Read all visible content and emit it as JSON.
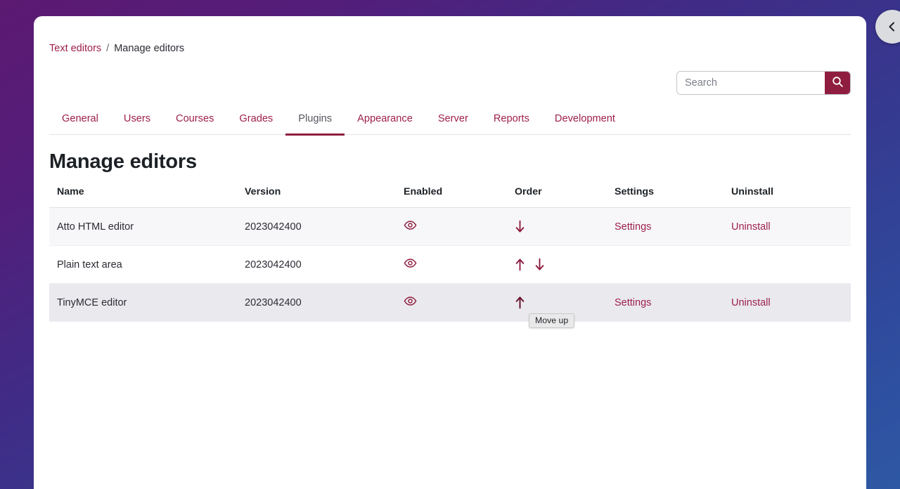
{
  "backdrop": {
    "drawer_toggle_icon": "chevron-left-icon"
  },
  "breadcrumb": {
    "parent": "Text editors",
    "separator": "/",
    "current": "Manage editors"
  },
  "search": {
    "placeholder": "Search",
    "value": "",
    "button_icon": "search-icon"
  },
  "tabs": [
    {
      "label": "General",
      "active": false
    },
    {
      "label": "Users",
      "active": false
    },
    {
      "label": "Courses",
      "active": false
    },
    {
      "label": "Grades",
      "active": false
    },
    {
      "label": "Plugins",
      "active": true
    },
    {
      "label": "Appearance",
      "active": false
    },
    {
      "label": "Server",
      "active": false
    },
    {
      "label": "Reports",
      "active": false
    },
    {
      "label": "Development",
      "active": false
    }
  ],
  "page": {
    "title": "Manage editors"
  },
  "table": {
    "headers": {
      "name": "Name",
      "version": "Version",
      "enabled": "Enabled",
      "order": "Order",
      "settings": "Settings",
      "uninstall": "Uninstall"
    },
    "rows": [
      {
        "name": "Atto HTML editor",
        "version": "2023042400",
        "enabled_icon": "eye-icon",
        "order_icons": [
          "arrow-down-icon"
        ],
        "settings_label": "Settings",
        "uninstall_label": "Uninstall"
      },
      {
        "name": "Plain text area",
        "version": "2023042400",
        "enabled_icon": "eye-icon",
        "order_icons": [
          "arrow-up-icon",
          "arrow-down-icon"
        ],
        "settings_label": "",
        "uninstall_label": ""
      },
      {
        "name": "TinyMCE editor",
        "version": "2023042400",
        "enabled_icon": "eye-icon",
        "order_icons": [
          "arrow-up-icon"
        ],
        "settings_label": "Settings",
        "uninstall_label": "Uninstall"
      }
    ]
  },
  "tooltip": {
    "text": "Move up"
  },
  "colors": {
    "brand_maroon": "#8f1d3f",
    "link_maroon": "#9e1f4a",
    "backdrop_purple": "#5c1a72",
    "backdrop_blue": "#2e58a4",
    "row_shaded": "#f7f7f9",
    "row_hovered": "#eaeaee"
  }
}
